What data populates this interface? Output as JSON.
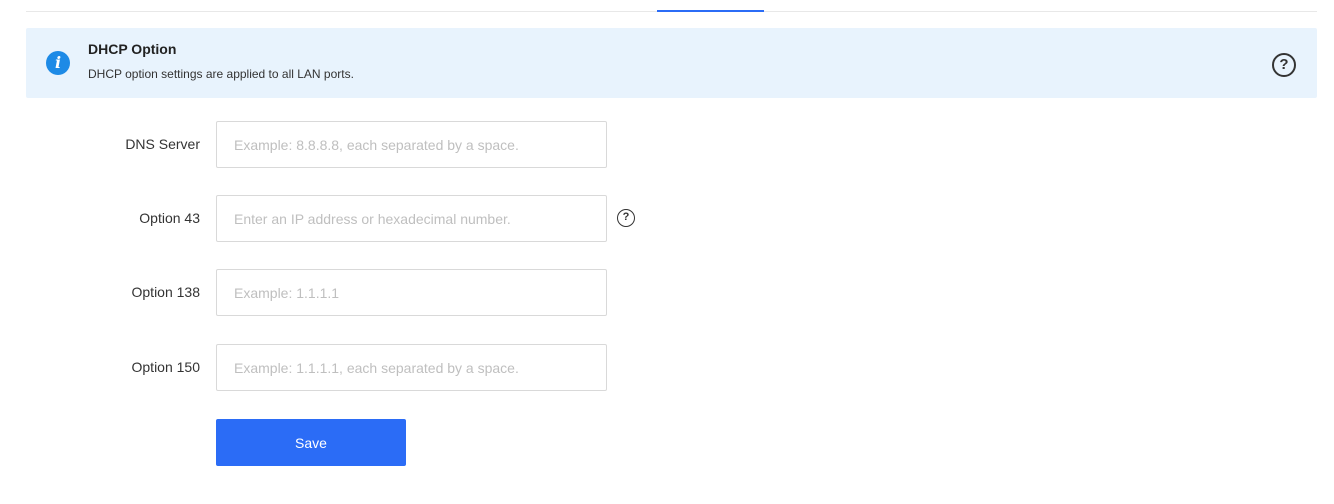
{
  "banner": {
    "icon": "info-icon",
    "icon_glyph": "i",
    "title": "DHCP Option",
    "description": "DHCP option settings are applied to all LAN ports.",
    "help_icon": "help-circle-icon",
    "help_glyph": "?"
  },
  "form": {
    "dns_server": {
      "label": "DNS Server",
      "value": "",
      "placeholder": "Example: 8.8.8.8, each separated by a space."
    },
    "option43": {
      "label": "Option 43",
      "value": "",
      "placeholder": "Enter an IP address or hexadecimal number.",
      "help_glyph": "?"
    },
    "option138": {
      "label": "Option 138",
      "value": "",
      "placeholder": "Example: 1.1.1.1"
    },
    "option150": {
      "label": "Option 150",
      "value": "",
      "placeholder": "Example: 1.1.1.1, each separated by a space."
    },
    "save_label": "Save"
  },
  "colors": {
    "primary": "#2b6cf6",
    "banner_bg": "#e8f3fd",
    "info_icon": "#1d8ae6"
  }
}
